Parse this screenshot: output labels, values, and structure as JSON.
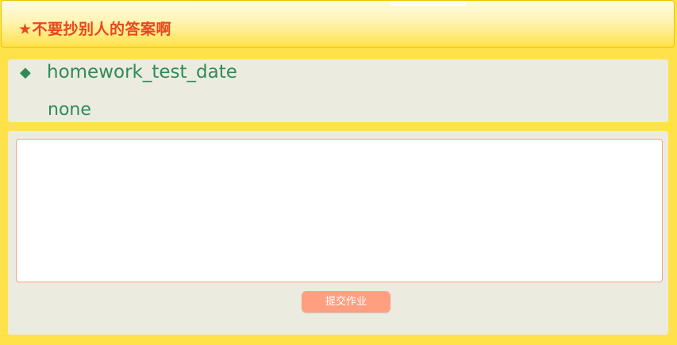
{
  "header": {
    "title": "★不要抄别人的答案啊"
  },
  "question": {
    "bullet": "◆",
    "title": "homework_test_date",
    "body": "none"
  },
  "answer": {
    "value": "",
    "placeholder": ""
  },
  "actions": {
    "submit_label": "提交作业"
  },
  "colors": {
    "background_yellow": "#ffe24a",
    "panel_gray": "#ecebe0",
    "title_red": "#e8461f",
    "question_green": "#2e8b57",
    "button_salmon": "#ff9f80"
  }
}
